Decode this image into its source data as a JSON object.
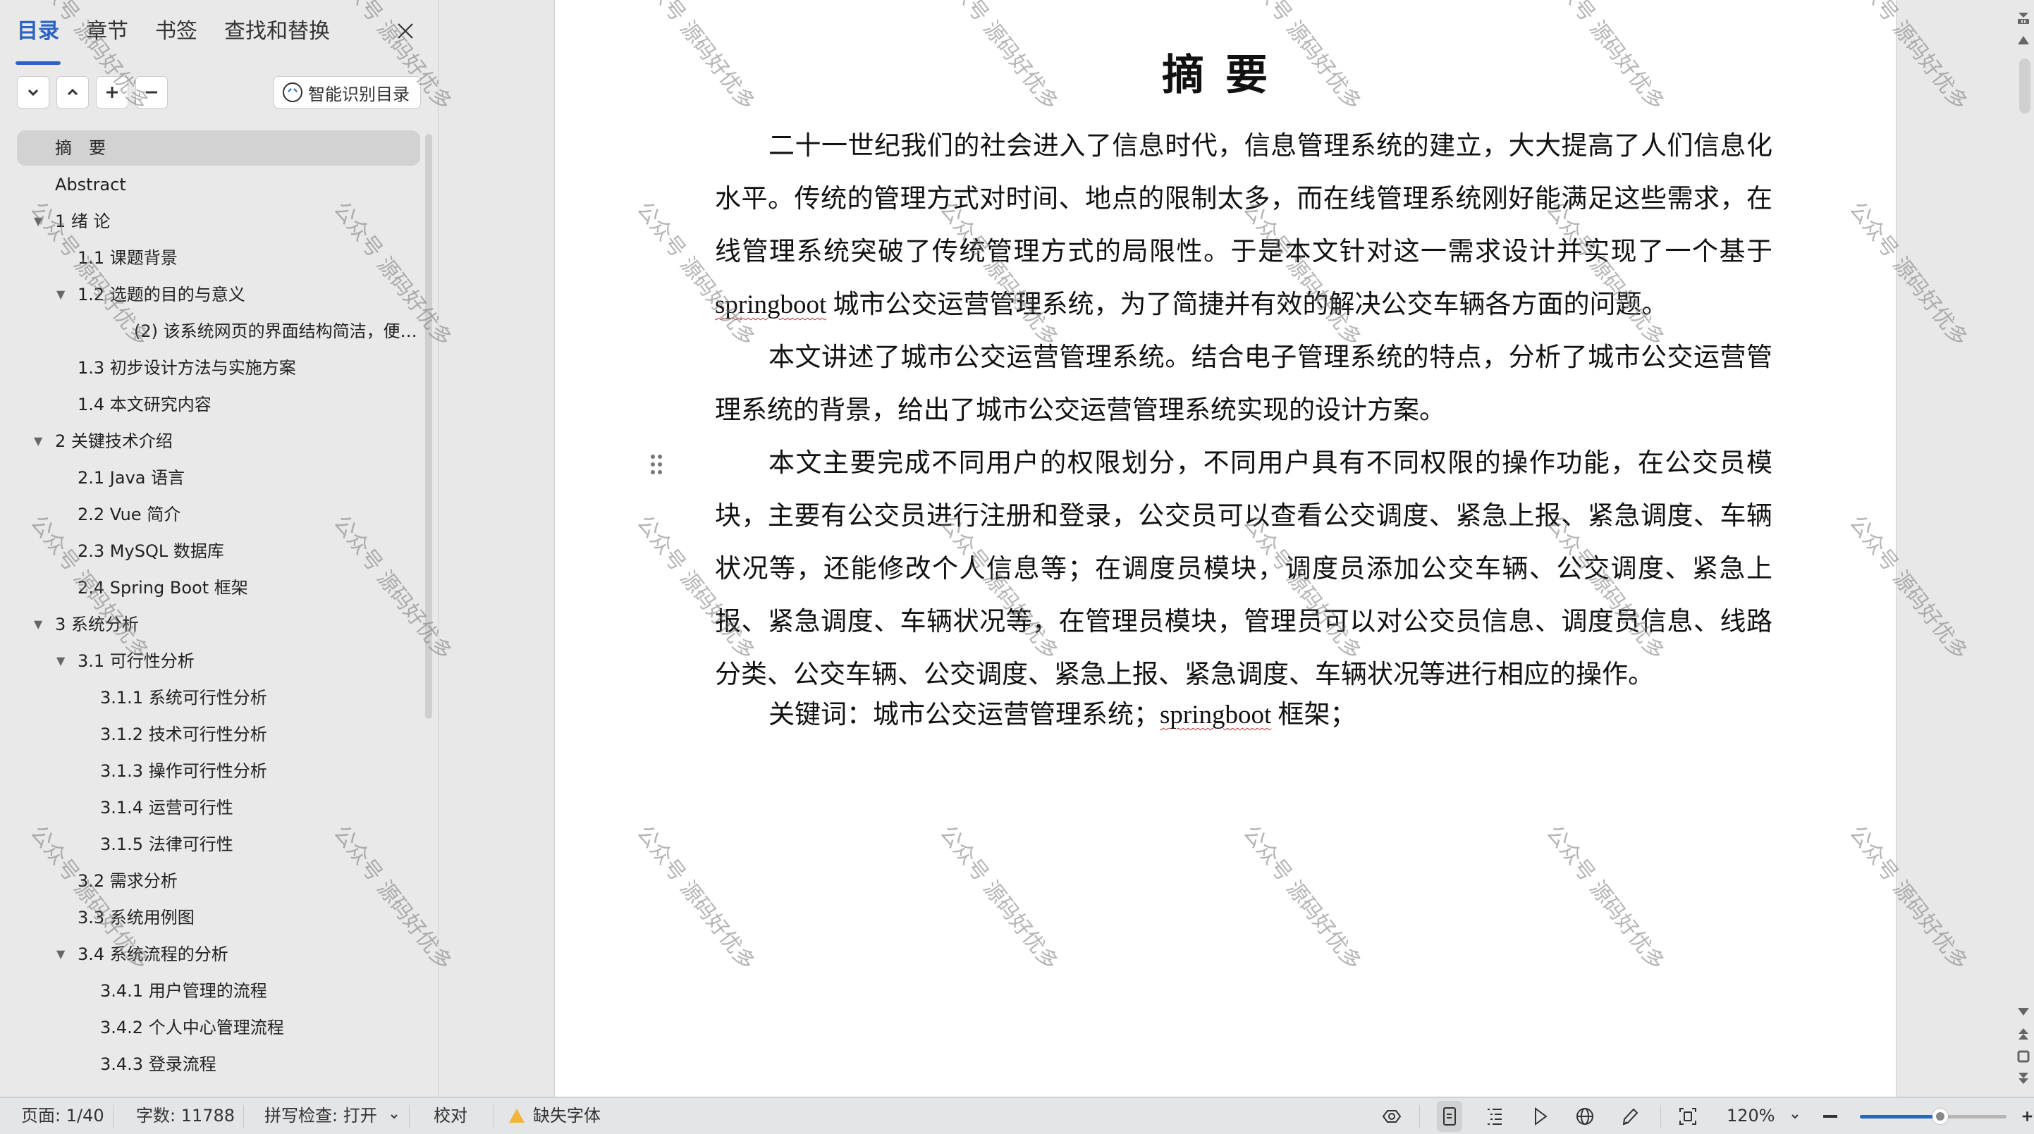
{
  "sidebar": {
    "tabs": [
      {
        "label": "目录",
        "active": true
      },
      {
        "label": "章节",
        "active": false
      },
      {
        "label": "书签",
        "active": false
      },
      {
        "label": "查找和替换",
        "active": false
      }
    ],
    "close_label": "×",
    "smart_toc_label": "智能识别目录",
    "toc": [
      {
        "label": "摘　要",
        "level": 0,
        "expandable": false,
        "selected": true
      },
      {
        "label": "Abstract",
        "level": 0,
        "expandable": false
      },
      {
        "label": "1 绪  论",
        "level": 0,
        "expandable": true
      },
      {
        "label": "1.1  课题背景",
        "level": 1,
        "expandable": false
      },
      {
        "label": "1.2  选题的目的与意义",
        "level": 1,
        "expandable": true
      },
      {
        "label": "(2) 该系统网页的界面结构简洁，便…",
        "level": 2,
        "expandable": false,
        "extra_indent": true
      },
      {
        "label": "1.3  初步设计方法与实施方案",
        "level": 1,
        "expandable": false
      },
      {
        "label": "1.4  本文研究内容",
        "level": 1,
        "expandable": false
      },
      {
        "label": "2  关键技术介绍",
        "level": 0,
        "expandable": true
      },
      {
        "label": "2.1 Java 语言",
        "level": 1,
        "expandable": false
      },
      {
        "label": "2.2 Vue 简介",
        "level": 1,
        "expandable": false
      },
      {
        "label": "2.3   MySQL 数据库",
        "level": 1,
        "expandable": false
      },
      {
        "label": "2.4 Spring Boot 框架",
        "level": 1,
        "expandable": false
      },
      {
        "label": "3  系统分析",
        "level": 0,
        "expandable": true
      },
      {
        "label": "3.1 可行性分析",
        "level": 1,
        "expandable": true
      },
      {
        "label": "3.1.1 系统可行性分析",
        "level": 2,
        "expandable": false
      },
      {
        "label": "3.1.2   技术可行性分析",
        "level": 2,
        "expandable": false
      },
      {
        "label": "3.1.3  操作可行性分析",
        "level": 2,
        "expandable": false
      },
      {
        "label": "3.1.4 运营可行性",
        "level": 2,
        "expandable": false
      },
      {
        "label": "3.1.5 法律可行性",
        "level": 2,
        "expandable": false
      },
      {
        "label": "3.2  需求分析",
        "level": 1,
        "expandable": false
      },
      {
        "label": "3.3 系统用例图",
        "level": 1,
        "expandable": false
      },
      {
        "label": "3.4 系统流程的分析",
        "level": 1,
        "expandable": true
      },
      {
        "label": "3.4.1  用户管理的流程",
        "level": 2,
        "expandable": false
      },
      {
        "label": "3.4.2  个人中心管理流程",
        "level": 2,
        "expandable": false
      },
      {
        "label": "3.4.3  登录流程",
        "level": 2,
        "expandable": false
      }
    ]
  },
  "document": {
    "title": "摘要",
    "paragraphs": {
      "p1_before": "二十一世纪我们的社会进入了信息时代，信息管理系统的建立，大大提高了人们信息化水平。传统的管理方式对时间、地点的限制太多，而在线管理系统刚好能满足这些需求，在线管理系统突破了传统管理方式的局限性。于是本文针对这一需求设计并实现了一个基于 ",
      "p1_term": "springboot",
      "p1_after": " 城市公交运营管理系统，为了简捷并有效的解决公交车辆各方面的问题。",
      "p2": "本文讲述了城市公交运营管理系统。结合电子管理系统的特点，分析了城市公交运营管理系统的背景，给出了城市公交运营管理系统实现的设计方案。",
      "p3": "本文主要完成不同用户的权限划分，不同用户具有不同权限的操作功能，在公交员模块，主要有公交员进行注册和登录，公交员可以查看公交调度、紧急上报、紧急调度、车辆状况等，还能修改个人信息等；在调度员模块，调度员添加公交车辆、公交调度、紧急上报、紧急调度、车辆状况等，在管理员模块，管理员可以对公交员信息、调度员信息、线路分类、公交车辆、公交调度、紧急上报、紧急调度、车辆状况等进行相应的操作。"
    },
    "keywords": {
      "label": "关键词：",
      "kw1": "城市公交运营管理系统；",
      "kw2_term": "springboot",
      "kw2_after": " 框架；"
    },
    "watermark": "公众号 源码好优多"
  },
  "status_bar": {
    "page": "页面: 1/40",
    "word_count": "字数: 11788",
    "spell_check": "拼写检查: 打开",
    "proofread": "校对",
    "missing_font": "缺失字体",
    "zoom": "120%",
    "zoom_slider_fraction": 0.55
  },
  "colors": {
    "accent": "#2b62c4",
    "warning": "#f3b43b"
  }
}
